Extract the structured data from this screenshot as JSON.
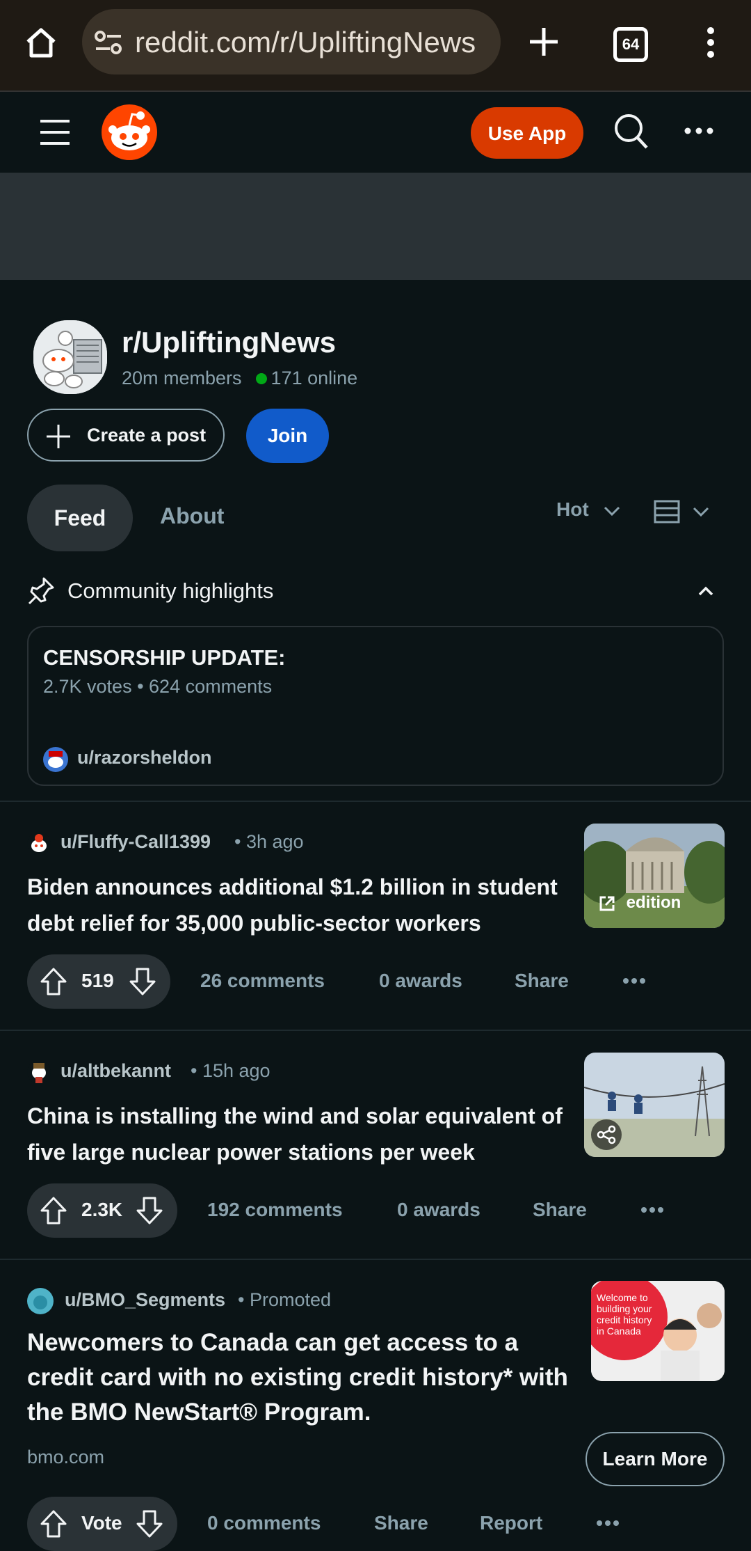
{
  "browser": {
    "url": "reddit.com/r/UpliftingNews",
    "tab_count": "64",
    "icons": [
      "home-icon",
      "site-settings-icon",
      "new-tab-icon",
      "tab-switcher-icon",
      "menu-icon"
    ]
  },
  "header": {
    "use_app_label": "Use App",
    "icons": [
      "hamburger-icon",
      "reddit-logo",
      "search-icon",
      "more-icon"
    ],
    "accent": "#d93a00"
  },
  "community": {
    "name": "r/UpliftingNews",
    "members": "20m members",
    "online": "171 online",
    "create_post_label": "Create a post",
    "join_label": "Join"
  },
  "tabs": {
    "feed": "Feed",
    "about": "About",
    "sort": "Hot"
  },
  "highlights": {
    "title": "Community highlights",
    "card": {
      "title": "CENSORSHIP UPDATE:",
      "meta": "2.7K votes • 624 comments",
      "user": "u/razorsheldon"
    }
  },
  "posts": [
    {
      "author": "u/Fluffy-Call1399",
      "time": "• 3h ago",
      "title": "Biden announces additional $1.2 billion in student debt relief for 35,000 public-sector workers",
      "votes": "519",
      "comments": "26 comments",
      "awards": "0 awards",
      "share": "Share",
      "thumb_label": "edition"
    },
    {
      "author": "u/altbekannt",
      "time": "• 15h ago",
      "title": "China is installing the wind and solar equivalent of five large nuclear power stations per week",
      "votes": "2.3K",
      "comments": "192 comments",
      "awards": "0 awards",
      "share": "Share"
    }
  ],
  "ad": {
    "author": "u/BMO_Segments",
    "promoted": "• Promoted",
    "title": "Newcomers to Canada can get access to a credit card with no existing credit history* with the BMO NewStart® Program.",
    "domain": "bmo.com",
    "cta": "Learn More",
    "thumb_text": "Welcome to building your credit history in Canada",
    "vote_label": "Vote",
    "comments": "0 comments",
    "share": "Share",
    "report": "Report"
  }
}
